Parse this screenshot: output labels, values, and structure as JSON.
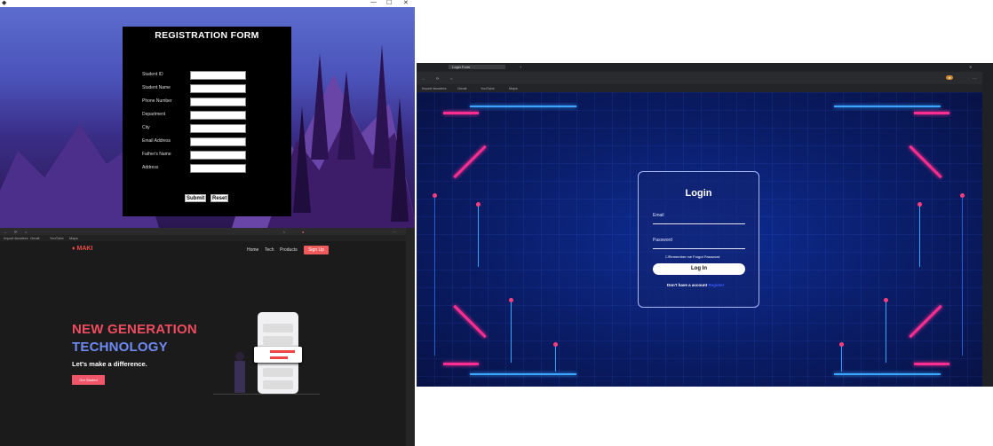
{
  "registration": {
    "title": "REGISTRATION FORM",
    "fields": [
      "Student ID",
      "Student Name",
      "Phone Number",
      "Department",
      "City",
      "Email Address",
      "Father's Name",
      "Address"
    ],
    "submit_label": "Submit",
    "reset_label": "Reset"
  },
  "maki": {
    "logo": "MAKI",
    "nav": [
      "Home",
      "Tech",
      "Products"
    ],
    "signup": "Sign Up",
    "headline_1": "NEW GENERATION",
    "headline_2": "TECHNOLOGY",
    "tagline": "Let's make a difference.",
    "cta": "Get Started"
  },
  "login": {
    "tab_title": "Login Form",
    "title": "Login",
    "email_placeholder": "Email",
    "password_placeholder": "Password",
    "remember": "Remember me  Forgot Password",
    "button": "Log In",
    "no_account": "Don't have a account",
    "register": "Register",
    "bookmarks": [
      "Import favorites",
      "Gmail",
      "YouTube",
      "Maps"
    ]
  },
  "colors": {
    "accent_red": "#ef4c60",
    "accent_blue": "#6f8af4",
    "neon_blue": "#3aa6ff",
    "neon_pink": "#ff2d8f"
  }
}
